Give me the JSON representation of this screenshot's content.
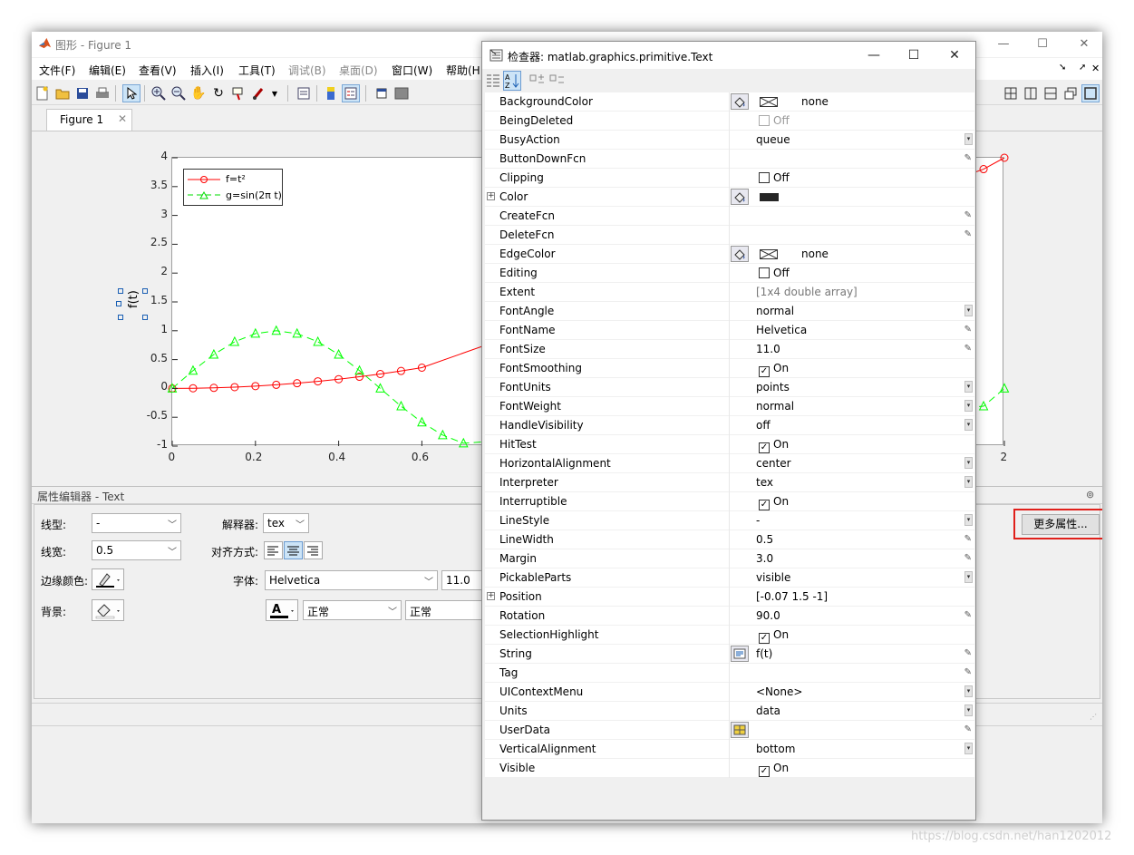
{
  "figure_window": {
    "title": "图形 - Figure 1",
    "menus": [
      "文件(F)",
      "编辑(E)",
      "查看(V)",
      "插入(I)",
      "工具(T)",
      "调试(B)",
      "桌面(D)",
      "窗口(W)",
      "帮助(H"
    ],
    "tab_label": "Figure 1",
    "ylabel": "f(t)",
    "legend": [
      "f=t²",
      "g=sin(2π t)"
    ],
    "yticks": [
      "4",
      "3.5",
      "3",
      "2.5",
      "2",
      "1.5",
      "1",
      "0.5",
      "0",
      "-0.5",
      "-1"
    ],
    "xticks": [
      "0",
      "0.2",
      "0.4",
      "0.6",
      "2"
    ]
  },
  "chart_data": {
    "type": "line",
    "xlim": [
      0,
      2
    ],
    "ylim": [
      -1,
      4
    ],
    "grid": false,
    "legend_position": "top-left",
    "ylabel": "f(t)",
    "series": [
      {
        "name": "f=t²",
        "color": "#ff0000",
        "marker": "circle",
        "linestyle": "solid",
        "x": [
          0,
          0.05,
          0.1,
          0.15,
          0.2,
          0.25,
          0.3,
          0.35,
          0.4,
          0.45,
          0.5,
          0.55,
          0.6,
          1.95,
          2.0
        ],
        "y": [
          0,
          0.0025,
          0.01,
          0.0225,
          0.04,
          0.0625,
          0.09,
          0.1225,
          0.16,
          0.2025,
          0.25,
          0.3025,
          0.36,
          3.8025,
          4.0
        ]
      },
      {
        "name": "g=sin(2π t)",
        "color": "#00ff00",
        "marker": "triangle",
        "linestyle": "dashed",
        "x": [
          0,
          0.05,
          0.1,
          0.15,
          0.2,
          0.25,
          0.3,
          0.35,
          0.4,
          0.45,
          0.5,
          0.55,
          0.6,
          0.65,
          0.7,
          1.95,
          2.0
        ],
        "y": [
          0,
          0.309,
          0.588,
          0.809,
          0.951,
          1.0,
          0.951,
          0.809,
          0.588,
          0.309,
          0,
          -0.309,
          -0.588,
          -0.809,
          -0.951,
          -0.309,
          0
        ]
      }
    ]
  },
  "property_editor": {
    "title": "属性编辑器 - Text",
    "linestyle_label": "线型:",
    "linestyle_value": "-",
    "linewidth_label": "线宽:",
    "linewidth_value": "0.5",
    "edgecolor_label": "边缘颜色:",
    "background_label": "背景:",
    "interpreter_label": "解释器:",
    "interpreter_value": "tex",
    "alignment_label": "对齐方式:",
    "font_label": "字体:",
    "font_value": "Helvetica",
    "fontsize_value": "11.0",
    "angle_value": "正常",
    "weight_value": "正常",
    "more_props_button": "更多属性..."
  },
  "inspector": {
    "title": "检查器:  matlab.graphics.primitive.Text",
    "properties": [
      {
        "name": "BackgroundColor",
        "value": "none",
        "kind": "color-none",
        "picker": true
      },
      {
        "name": "BeingDeleted",
        "value": "Off",
        "kind": "checkbox-disabled"
      },
      {
        "name": "BusyAction",
        "value": "queue",
        "kind": "dropdown"
      },
      {
        "name": "ButtonDownFcn",
        "value": "",
        "kind": "edit"
      },
      {
        "name": "Clipping",
        "value": "Off",
        "kind": "checkbox"
      },
      {
        "name": "Color",
        "value": "",
        "kind": "color-black",
        "picker": true,
        "expandable": true
      },
      {
        "name": "CreateFcn",
        "value": "",
        "kind": "edit"
      },
      {
        "name": "DeleteFcn",
        "value": "",
        "kind": "edit"
      },
      {
        "name": "EdgeColor",
        "value": "none",
        "kind": "color-none",
        "picker": true
      },
      {
        "name": "Editing",
        "value": "Off",
        "kind": "checkbox"
      },
      {
        "name": "Extent",
        "value": "[1x4  double array]",
        "kind": "readonly"
      },
      {
        "name": "FontAngle",
        "value": "normal",
        "kind": "dropdown"
      },
      {
        "name": "FontName",
        "value": "Helvetica",
        "kind": "edit"
      },
      {
        "name": "FontSize",
        "value": "11.0",
        "kind": "edit"
      },
      {
        "name": "FontSmoothing",
        "value": "On",
        "kind": "checkbox-on"
      },
      {
        "name": "FontUnits",
        "value": "points",
        "kind": "dropdown"
      },
      {
        "name": "FontWeight",
        "value": "normal",
        "kind": "dropdown"
      },
      {
        "name": "HandleVisibility",
        "value": "off",
        "kind": "dropdown"
      },
      {
        "name": "HitTest",
        "value": "On",
        "kind": "checkbox-on"
      },
      {
        "name": "HorizontalAlignment",
        "value": "center",
        "kind": "dropdown"
      },
      {
        "name": "Interpreter",
        "value": "tex",
        "kind": "dropdown"
      },
      {
        "name": "Interruptible",
        "value": "On",
        "kind": "checkbox-on"
      },
      {
        "name": "LineStyle",
        "value": "-",
        "kind": "dropdown"
      },
      {
        "name": "LineWidth",
        "value": "0.5",
        "kind": "edit"
      },
      {
        "name": "Margin",
        "value": "3.0",
        "kind": "edit"
      },
      {
        "name": "PickableParts",
        "value": "visible",
        "kind": "dropdown"
      },
      {
        "name": "Position",
        "value": "[-0.07 1.5 -1]",
        "kind": "plain",
        "expandable": true
      },
      {
        "name": "Rotation",
        "value": "90.0",
        "kind": "edit"
      },
      {
        "name": "SelectionHighlight",
        "value": "On",
        "kind": "checkbox-on"
      },
      {
        "name": "String",
        "value": "f(t)",
        "kind": "edit",
        "picker": true
      },
      {
        "name": "Tag",
        "value": "",
        "kind": "edit"
      },
      {
        "name": "UIContextMenu",
        "value": "<None>",
        "kind": "dropdown"
      },
      {
        "name": "Units",
        "value": "data",
        "kind": "dropdown"
      },
      {
        "name": "UserData",
        "value": "",
        "kind": "edit",
        "picker": true
      },
      {
        "name": "VerticalAlignment",
        "value": "bottom",
        "kind": "dropdown"
      },
      {
        "name": "Visible",
        "value": "On",
        "kind": "checkbox-on"
      }
    ]
  },
  "watermark": "https://blog.csdn.net/han1202012",
  "colors": {
    "highlight_box": "#e0201b",
    "selected_tool": "#cce4f7"
  }
}
